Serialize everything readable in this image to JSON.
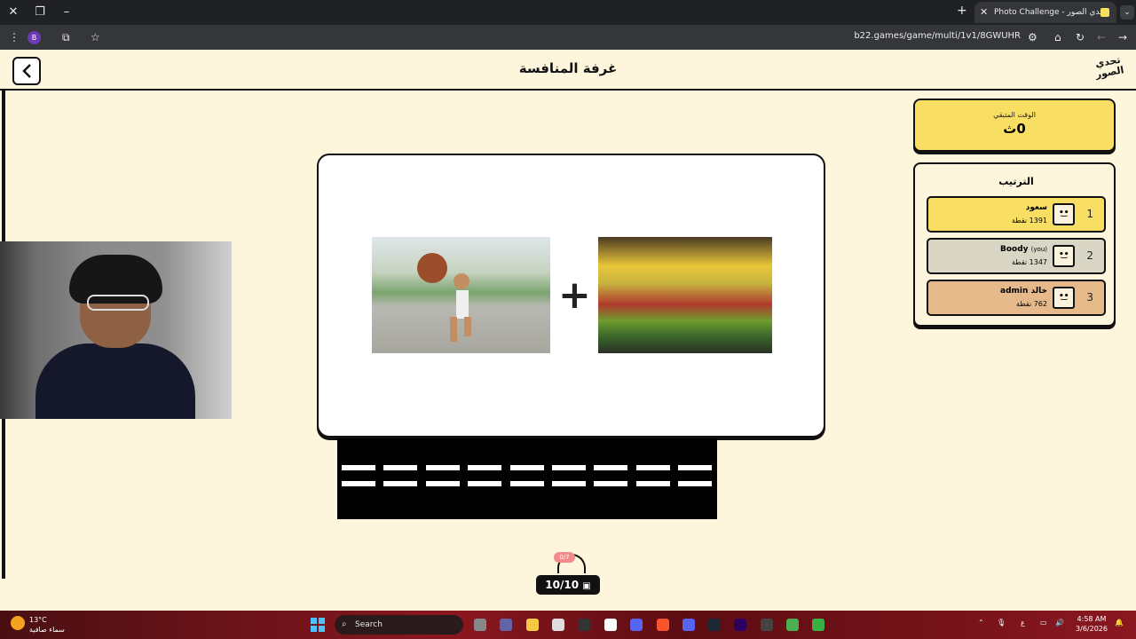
{
  "browser": {
    "tab_title": "Photo Challenge - تحدي الصور",
    "url": "b22.games/game/multi/1v1/8GWUHR",
    "profile_initial": "B"
  },
  "header": {
    "title": "غرفة المنافسة",
    "logo_text": "تحدي الصور"
  },
  "timer": {
    "label": "الوقت المتبقي",
    "value": "0ث"
  },
  "ranking": {
    "title": "الترتيب",
    "players": [
      {
        "rank": "1",
        "name": "سعود",
        "you_tag": "",
        "points": "1391 نقطة",
        "color": "#f8de63"
      },
      {
        "rank": "2",
        "name": "Boody",
        "you_tag": "(you)",
        "points": "1347 نقطة",
        "color": "#d9d6c6"
      },
      {
        "rank": "3",
        "name": "خالد admin",
        "you_tag": "",
        "points": "762 نقطة",
        "color": "#e6b98a"
      }
    ]
  },
  "game": {
    "operator": "+",
    "answer_slots": 9,
    "hint_badge": "0/7",
    "progress": "10/10"
  },
  "taskbar": {
    "temperature": "13°C",
    "weather": "سماء صافية",
    "search_label": "Search",
    "time": "4:58 AM",
    "date": "3/6/2026",
    "lang": "ع"
  }
}
